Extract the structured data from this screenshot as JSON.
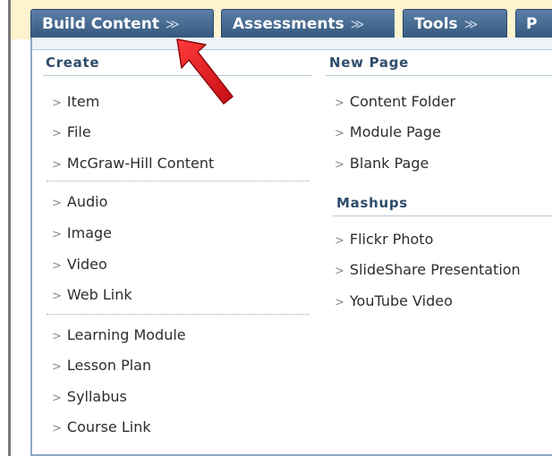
{
  "tabs": [
    {
      "label": "Build Content",
      "chevron": "≫"
    },
    {
      "label": "Assessments",
      "chevron": "≫"
    },
    {
      "label": "Tools",
      "chevron": "≫"
    },
    {
      "label": "P"
    }
  ],
  "menu": {
    "create": {
      "heading": "Create",
      "group1": [
        "Item",
        "File",
        "McGraw-Hill Content"
      ],
      "group2": [
        "Audio",
        "Image",
        "Video",
        "Web Link"
      ],
      "group3": [
        "Learning Module",
        "Lesson Plan",
        "Syllabus",
        "Course Link"
      ]
    },
    "new_page": {
      "heading": "New Page",
      "items": [
        "Content Folder",
        "Module Page",
        "Blank Page"
      ]
    },
    "mashups": {
      "heading": "Mashups",
      "items": [
        "Flickr Photo",
        "SlideShare Presentation",
        "YouTube Video"
      ]
    }
  },
  "colors": {
    "tab_bg": "#35597f",
    "toolbar_bg": "#fdf3cf",
    "heading_text": "#2e4c6a",
    "arrow": "#e3141b"
  },
  "icons": {
    "menu_chevron": "double-chevron-down-icon",
    "item_marker": "angle-right-icon",
    "pointer": "red-arrow-annotation"
  }
}
